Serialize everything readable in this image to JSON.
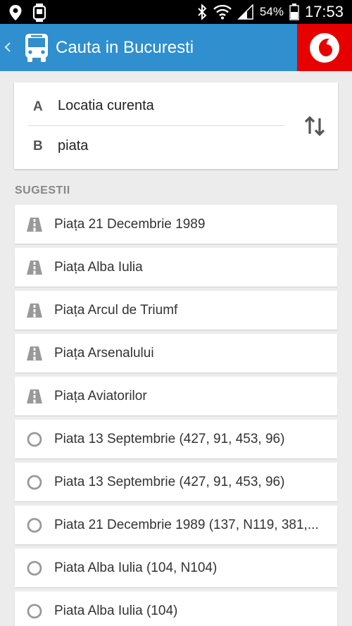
{
  "status_bar": {
    "battery_percent": "54%",
    "time": "17:53",
    "left_icons": [
      "location-pin-icon",
      "smartwatch-icon"
    ],
    "right_icons": [
      "bluetooth-icon",
      "wifi-icon",
      "signal-icon",
      "battery-icon"
    ]
  },
  "app_bar": {
    "title": "Cauta in Bucuresti",
    "background": "#2f8fcf",
    "brand_color": "#e60000"
  },
  "route": {
    "from_letter": "A",
    "from_value": "Locatia curenta",
    "to_letter": "B",
    "to_value": "piata"
  },
  "suggestions": {
    "title": "SUGESTII",
    "items": [
      {
        "label": "Piața 21 Decembrie 1989",
        "icon": "road-icon"
      },
      {
        "label": "Piața Alba Iulia",
        "icon": "road-icon"
      },
      {
        "label": "Piața Arcul de Triumf",
        "icon": "road-icon"
      },
      {
        "label": "Piața Arsenalului",
        "icon": "road-icon"
      },
      {
        "label": "Piața Aviatorilor",
        "icon": "road-icon"
      },
      {
        "label": "Piata 13 Septembrie (427, 91, 453, 96)",
        "icon": "stop-circle-icon"
      },
      {
        "label": "Piata 13 Septembrie (427, 91, 453, 96)",
        "icon": "stop-circle-icon"
      },
      {
        "label": "Piata 21 Decembrie 1989 (137, N119, 381,...",
        "icon": "stop-circle-icon"
      },
      {
        "label": "Piata Alba Iulia (104, N104)",
        "icon": "stop-circle-icon"
      },
      {
        "label": "Piata Alba Iulia (104)",
        "icon": "stop-circle-icon"
      }
    ]
  }
}
